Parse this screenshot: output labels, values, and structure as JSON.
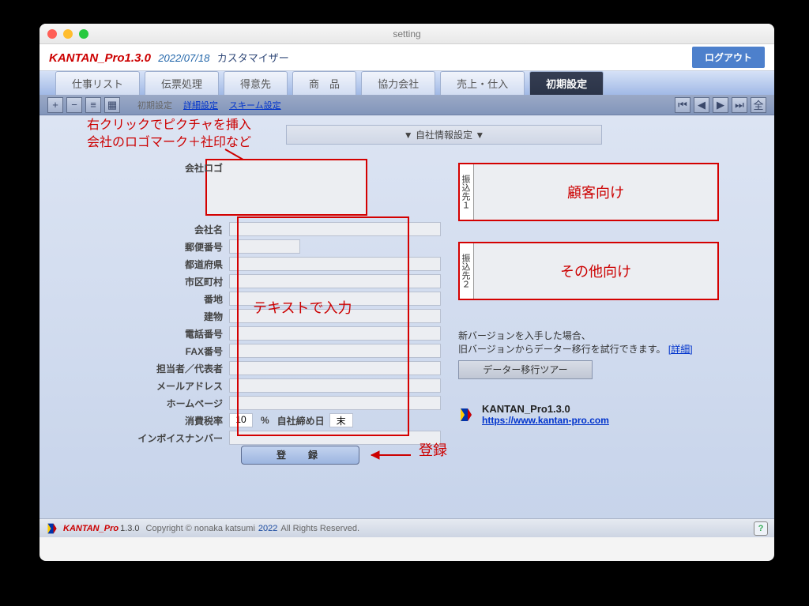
{
  "window": {
    "title": "setting"
  },
  "header": {
    "app_name": "KANTAN_Pro1.3.0",
    "date": "2022/07/18",
    "subtitle": "カスタマイザー",
    "logout": "ログアウト"
  },
  "tabs": [
    {
      "label": "仕事リスト"
    },
    {
      "label": "伝票処理"
    },
    {
      "label": "得意先"
    },
    {
      "label": "商　品"
    },
    {
      "label": "協力会社"
    },
    {
      "label": "売上・仕入"
    },
    {
      "label": "初期設定",
      "active": true
    }
  ],
  "toolbar": {
    "breadcrumb": "初期設定",
    "links": {
      "detail": "詳細設定",
      "scheme": "スキーム設定"
    }
  },
  "annotations": {
    "logo_hint_line1": "右クリックでピクチャを挿入",
    "logo_hint_line2": "会社のロゴマーク＋社印など",
    "text_input_hint": "テキストで入力",
    "register_hint": "登録"
  },
  "section": {
    "title": "▼ 自社情報設定 ▼"
  },
  "form": {
    "labels": {
      "logo": "会社ロゴ",
      "company": "会社名",
      "postal": "郵便番号",
      "pref": "都道府県",
      "city": "市区町村",
      "addr": "番地",
      "building": "建物",
      "tel": "電話番号",
      "fax": "FAX番号",
      "rep": "担当者／代表者",
      "email": "メールアドレス",
      "hp": "ホームページ",
      "tax": "消費税率",
      "tax_unit": "%",
      "closing": "自社締め日",
      "invoice": "インボイスナンバー"
    },
    "tax_value": "10",
    "closing_value": "末",
    "register_btn": "登　録"
  },
  "banks": {
    "slot1_label": "振込先１",
    "slot1_desc": "顧客向け",
    "slot2_label": "振込先２",
    "slot2_desc": "その他向け"
  },
  "migration": {
    "line1": "新バージョンを入手した場合、",
    "line2": "旧バージョンからデーター移行を試行できます。",
    "detail_link": "[詳細]",
    "tour_btn": "データー移行ツアー"
  },
  "product": {
    "name": "KANTAN_Pro1.3.0",
    "url": "https://www.kantan-pro.com"
  },
  "footer": {
    "app": "KANTAN_Pro",
    "ver": "1.3.0",
    "copy1": "Copyright © nonaka katsumi",
    "year": "2022",
    "copy2": "All Rights Reserved."
  }
}
